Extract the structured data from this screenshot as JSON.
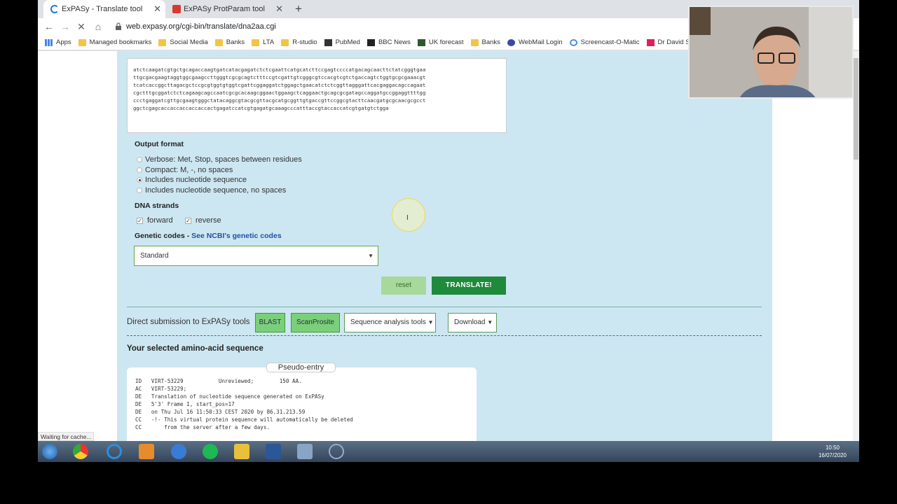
{
  "browser": {
    "tabs": [
      {
        "title": "ExPASy - Translate tool",
        "active": true
      },
      {
        "title": "ExPASy ProtParam tool",
        "active": false
      }
    ],
    "url": "web.expasy.org/cgi-bin/translate/dna2aa.cgi",
    "bookmarks": [
      "Apps",
      "Managed bookmarks",
      "Social Media",
      "Banks",
      "LTA",
      "R-studio",
      "PubMed",
      "BBC News",
      "UK forecast",
      "Banks",
      "WebMail Login",
      "Screencast-O-Matic",
      "Dr David Sm"
    ]
  },
  "sequence_text": "atctcaagatcgtgctgcagaccaagtgatcatacgagatctctcgaattcatgcatcttccgagtccccatgacagcaacttctatcgggtgaa\nttgcgacgaagtaggtggcgaagccttgggtcgcgcagtctttccgtcgattgtcgggcgtccacgtcgtctgaccagtctggtgcgcgaaacgt\ntcatcaccggcttagacgctccgcgtggtgtggtcgattcggaggatctggagctgaacatctctcggttagggattcacgaggacagccagaat\ncgctttgcggatctctcagaagcagccaatcgcgcacaagcggaactggaagctcaggaactgcagcgcgatagccaggatgccggaggttttgg\nccctgaggatcgttgcgaagtgggctatacaggcgtacgcgttacgcatgcggttgtgaccgttccggcgtacttcaacgatgcgcaacgcgcct\nggctcgagcaccaccaccaccaccactgagatccatcgtgagatgcaaagcccatttaccgtaccaccatcgtgatgtctgga",
  "output_format": {
    "title": "Output format",
    "options": [
      {
        "label": "Verbose: Met, Stop, spaces between residues",
        "selected": false
      },
      {
        "label": "Compact: M, -, no spaces",
        "selected": false
      },
      {
        "label": "Includes nucleotide sequence",
        "selected": true
      },
      {
        "label": "Includes nucleotide sequence, no spaces",
        "selected": false
      }
    ]
  },
  "dna_strands": {
    "title": "DNA strands",
    "forward": "forward",
    "reverse": "reverse"
  },
  "genetic_codes": {
    "title": "Genetic codes - ",
    "link": "See NCBI's genetic codes",
    "selected": "Standard"
  },
  "buttons": {
    "reset": "reset",
    "translate": "TRANSLATE!"
  },
  "direct_submission": {
    "label": "Direct submission to ExPASy tools",
    "blast": "BLAST",
    "scanprosite": "ScanProsite",
    "seq_tools": "Sequence analysis tools",
    "download": "Download"
  },
  "result": {
    "title": "Your selected amino-acid sequence",
    "tab": "Pseudo-entry",
    "lines": "ID   VIRT-53229           Unreviewed;        150 AA.\nAC   VIRT-53229;\nDE   Translation of nucleotide sequence generated on ExPASy\nDE   5'3' Frame 1, start_pos=17\nDE   on Thu Jul 16 11:50:33 CEST 2020 by 86.31.213.59\nCC   -!- This virtual protein sequence will automatically be deleted\nCC       from the server after a few days."
  },
  "status_text": "Waiting for cache...",
  "clock": {
    "time": "10:50",
    "date": "16/07/2020"
  }
}
